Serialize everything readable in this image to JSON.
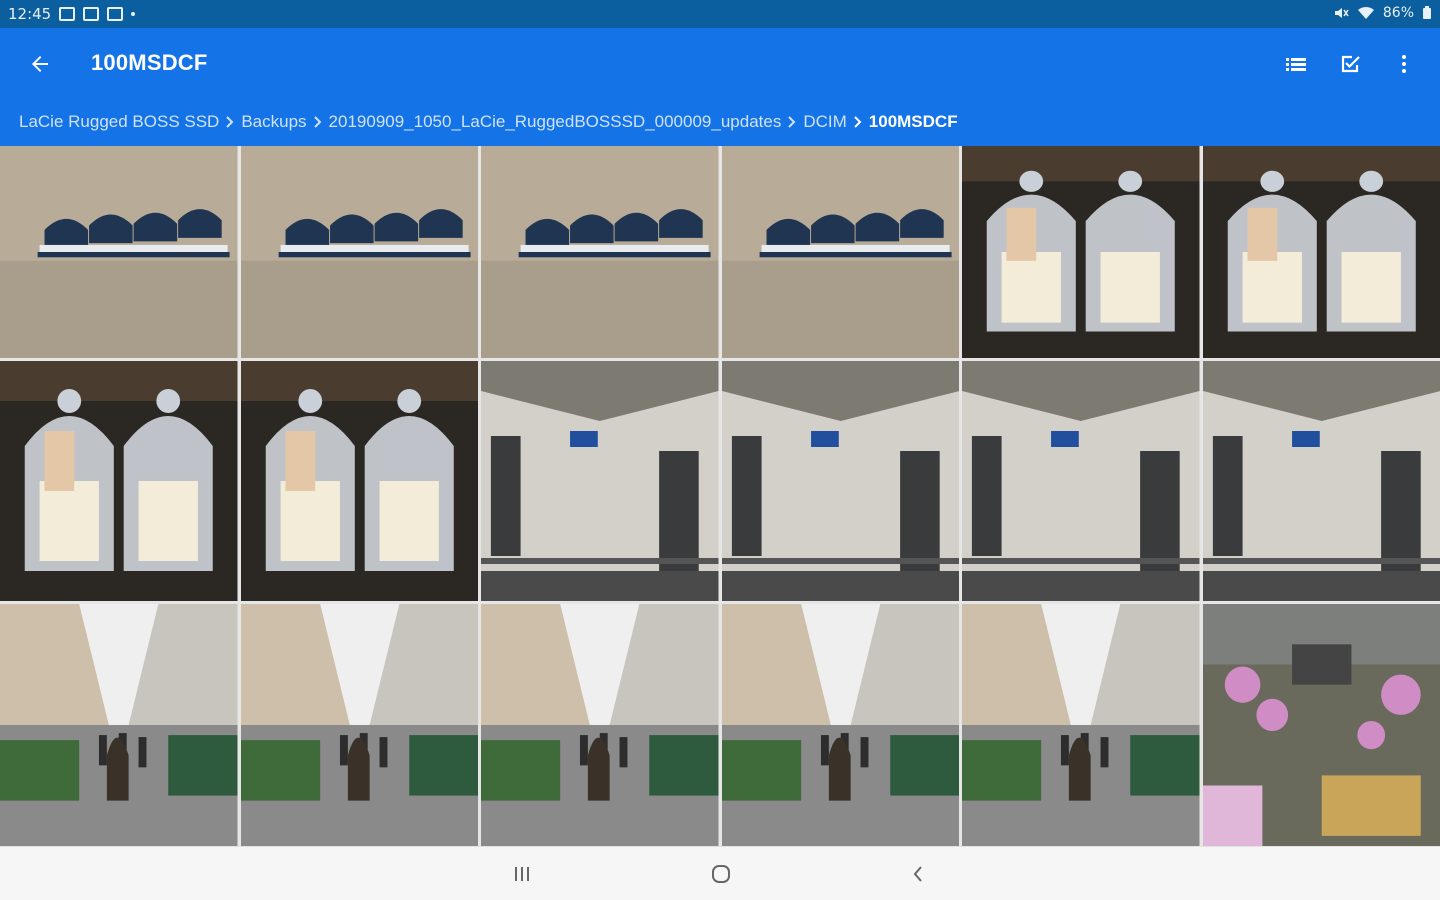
{
  "status_bar": {
    "time": "12:45",
    "battery": "86%",
    "icons": [
      "image-icon",
      "tv-icon",
      "message-icon",
      "mute-icon",
      "wifi-icon",
      "battery-icon"
    ]
  },
  "app_bar": {
    "title": "100MSDCF",
    "actions": [
      "list-view-icon",
      "select-icon",
      "more-vert-icon"
    ]
  },
  "breadcrumb": [
    {
      "label": "LaCie Rugged BOSS SSD"
    },
    {
      "label": "Backups"
    },
    {
      "label": "20190909_1050_LaCie_RuggedBOSSSD_000009_updates"
    },
    {
      "label": "DCIM"
    },
    {
      "label": "100MSDCF",
      "current": true
    }
  ],
  "photos": [
    {
      "subject": "wall-street-signs"
    },
    {
      "subject": "wall-street-signs"
    },
    {
      "subject": "wall-street-signs"
    },
    {
      "subject": "wall-street-signs"
    },
    {
      "subject": "glass-jars"
    },
    {
      "subject": "glass-jars"
    },
    {
      "subject": "glass-jars"
    },
    {
      "subject": "glass-jars"
    },
    {
      "subject": "building-corner"
    },
    {
      "subject": "building-corner"
    },
    {
      "subject": "building-corner"
    },
    {
      "subject": "building-corner"
    },
    {
      "subject": "street-scene"
    },
    {
      "subject": "street-scene"
    },
    {
      "subject": "street-scene"
    },
    {
      "subject": "street-scene"
    },
    {
      "subject": "street-scene"
    },
    {
      "subject": "flower-market"
    }
  ],
  "nav_bar": {
    "buttons": [
      "recents-icon",
      "home-icon",
      "back-nav-icon"
    ]
  },
  "colors": {
    "status_bar": "#0b5f9e",
    "app_bar": "#1473e6",
    "nav_bar": "#f6f6f6"
  }
}
